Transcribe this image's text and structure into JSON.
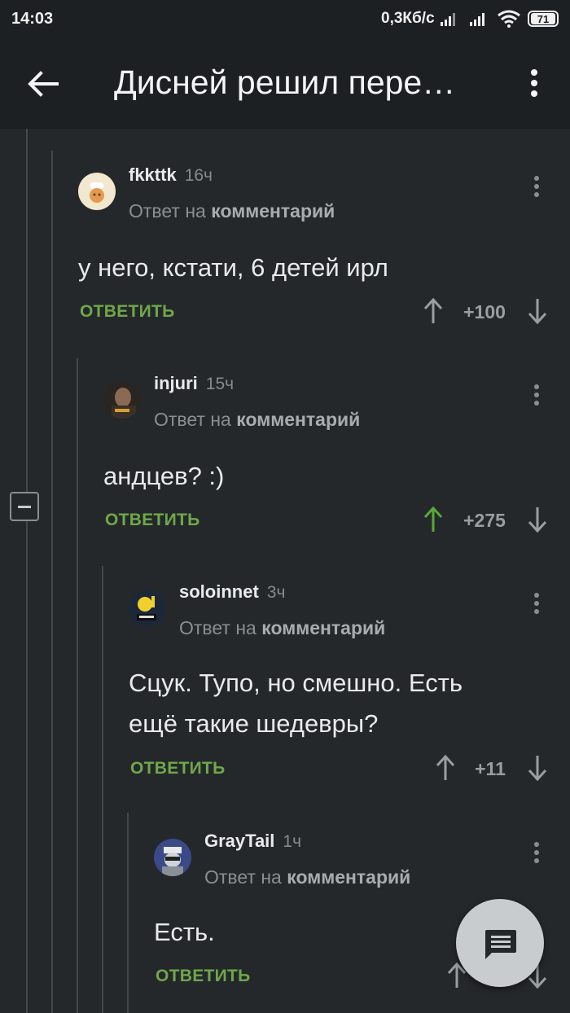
{
  "status_bar": {
    "time": "14:03",
    "speed": "0,3Кб/с",
    "battery": "71"
  },
  "app_bar": {
    "title": "Дисней решил пере…"
  },
  "labels": {
    "reply_to_prefix": "Ответ на",
    "reply_to_link": "комментарий",
    "reply_button": "ОТВЕТИТЬ"
  },
  "comments": [
    {
      "user": "fkkttk",
      "time": "16ч",
      "text": [
        "у него, кстати, 6 детей ирл"
      ],
      "score": "+100",
      "upvoted": false
    },
    {
      "user": "injuri",
      "time": "15ч",
      "text": [
        "андцев? :)"
      ],
      "score": "+275",
      "upvoted": true
    },
    {
      "user": "soloinnet",
      "time": "3ч",
      "text": [
        "Сцук. Тупо, но смешно. Есть",
        "ещё такие шедевры?"
      ],
      "score": "+11",
      "upvoted": false
    },
    {
      "user": "GrayTail",
      "time": "1ч",
      "text": [
        "Есть."
      ],
      "score": "",
      "upvoted": false
    }
  ],
  "colors": {
    "background": "#25282b",
    "bar": "#1d2023",
    "reply_green": "#6ea84a",
    "upvote_green": "#5aa83a",
    "fab": "#c9cccf"
  },
  "icons": [
    "back-arrow-icon",
    "more-vert-icon",
    "arrow-up-icon",
    "arrow-down-icon",
    "collapse-minus-icon",
    "chat-icon"
  ]
}
